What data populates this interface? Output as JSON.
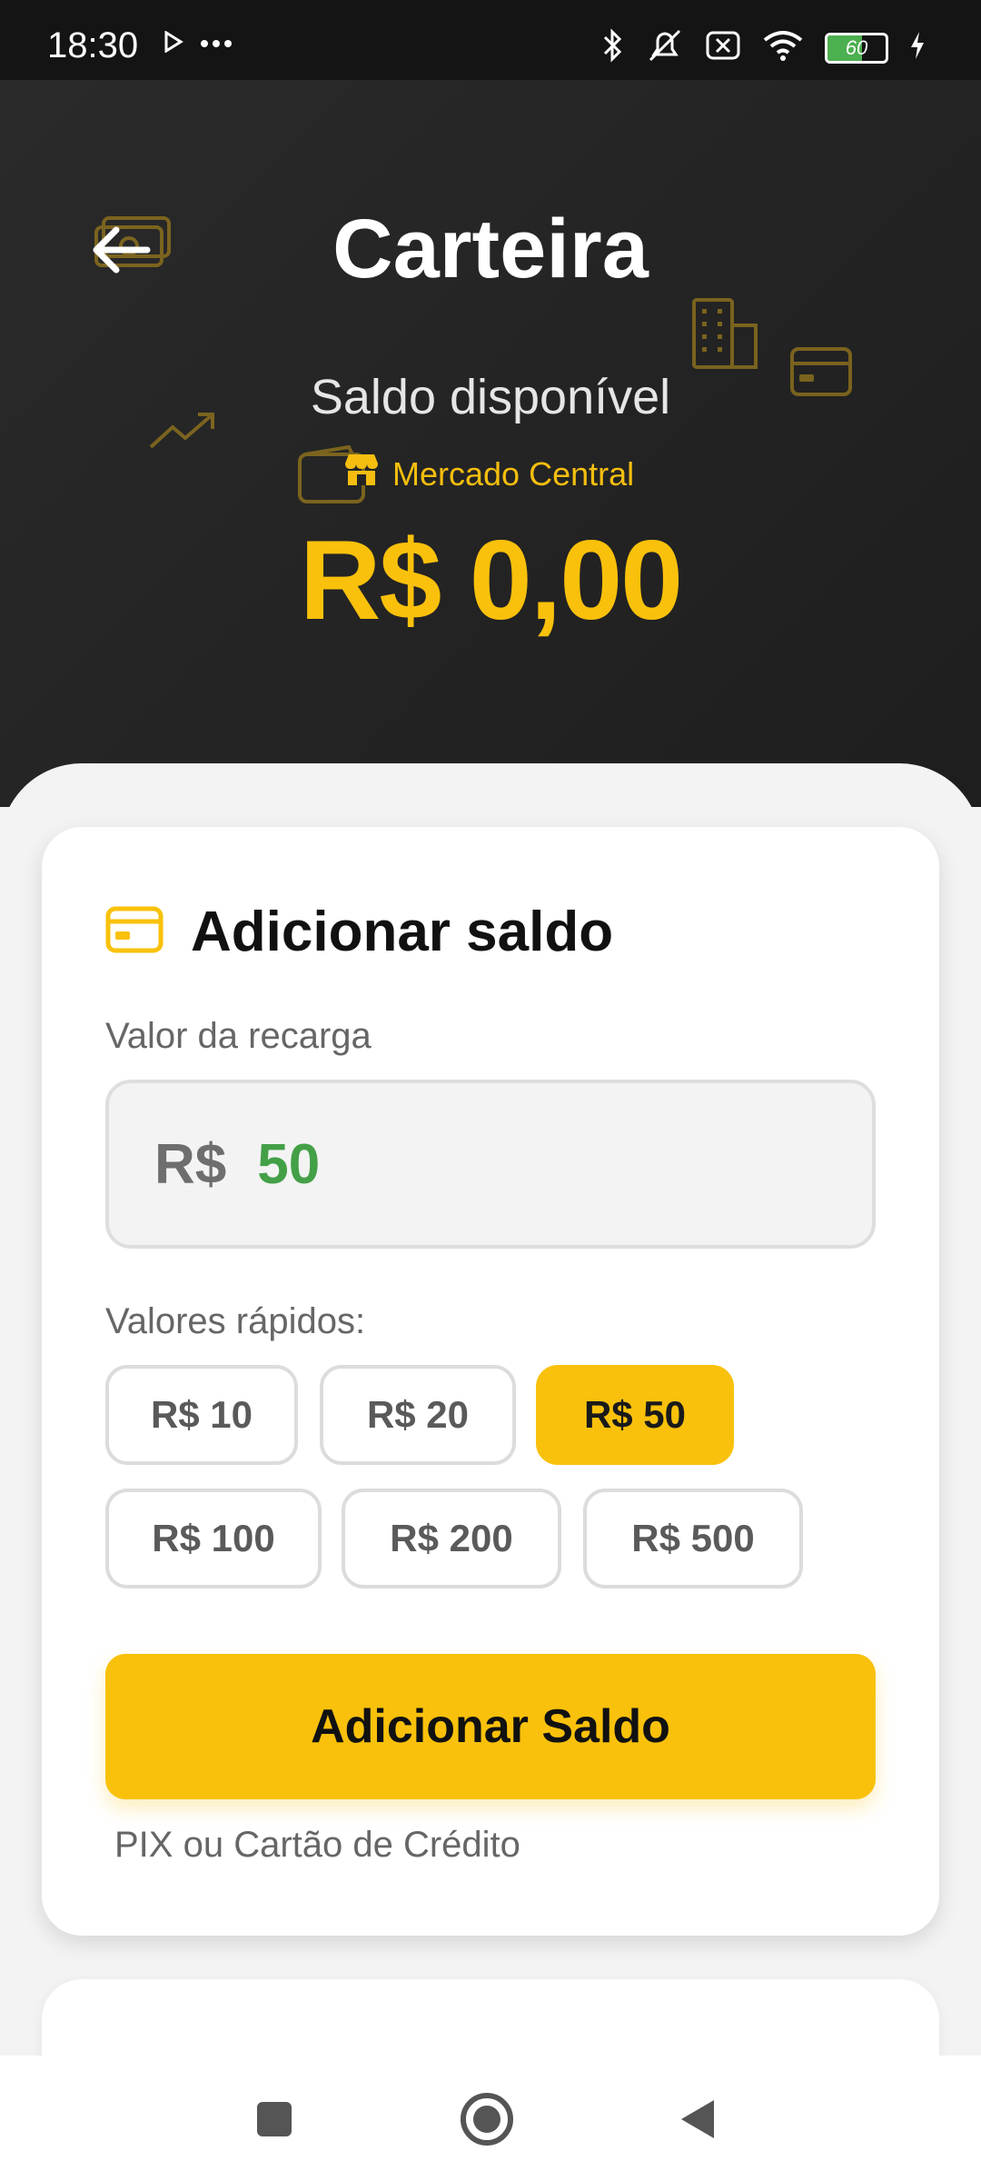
{
  "status_bar": {
    "time": "18:30",
    "battery_level": "60",
    "icons": [
      "play-icon",
      "more-dots-icon",
      "bluetooth-icon",
      "mute-icon",
      "sim-off-icon",
      "wifi-icon",
      "battery-icon",
      "charging-icon"
    ]
  },
  "header": {
    "title": "Carteira",
    "balance_label": "Saldo disponível",
    "store_name": "Mercado Central",
    "balance_value": "R$ 0,00"
  },
  "add_balance": {
    "title": "Adicionar saldo",
    "amount_label": "Valor da recarga",
    "currency_prefix": "R$",
    "amount_value": "50",
    "quick_label": "Valores rápidos:",
    "quick_values": [
      "R$ 10",
      "R$ 20",
      "R$ 50",
      "R$ 100",
      "R$ 200",
      "R$ 500"
    ],
    "selected_quick_value": "R$ 50",
    "submit_label": "Adicionar Saldo",
    "payment_hint": "PIX ou Cartão de Crédito"
  },
  "colors": {
    "accent": "#F9C10B",
    "header_bg": "#242424",
    "amount_green": "#43A047"
  },
  "nav": {
    "icons": [
      "recent-apps-icon",
      "home-icon",
      "back-icon"
    ]
  }
}
